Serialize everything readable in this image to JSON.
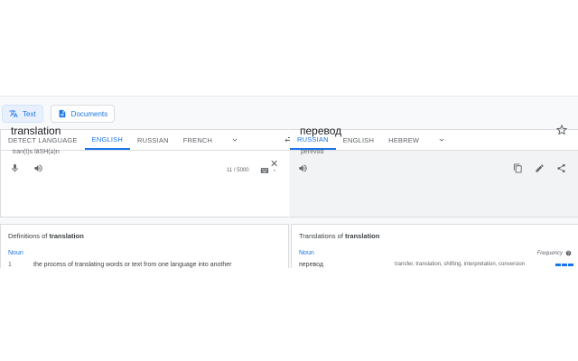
{
  "modes": {
    "text": "Text",
    "documents": "Documents"
  },
  "source_langs": [
    "DETECT LANGUAGE",
    "ENGLISH",
    "RUSSIAN",
    "FRENCH"
  ],
  "target_langs": [
    "RUSSIAN",
    "ENGLISH",
    "HEBREW"
  ],
  "source": {
    "text": "translation",
    "transliteration": "tran(t)s lāSH(ə)n",
    "char_count": "11 / 5000"
  },
  "target": {
    "text": "перевод",
    "transliteration": "perevod"
  },
  "definitions": {
    "title_prefix": "Definitions of ",
    "title_word": "translation",
    "pos": "Noun",
    "number": "1",
    "line": "the process of translating words or text from one language into another"
  },
  "translations": {
    "title_prefix": "Translations of ",
    "title_word": "translation",
    "pos": "Noun",
    "frequency_label": "Frequency",
    "word": "перевод",
    "synonyms": "transfer, translation, shifting, interpretation, conversion"
  },
  "colors": {
    "accent": "#1a73e8"
  }
}
